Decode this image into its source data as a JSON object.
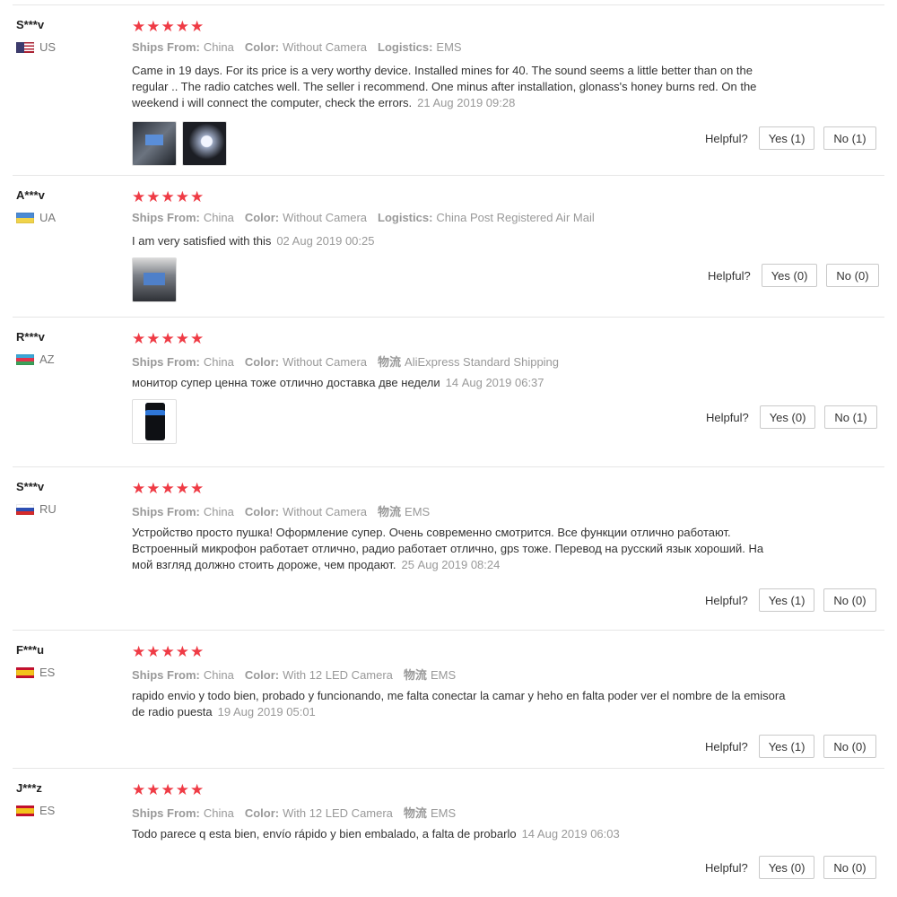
{
  "helpful_label": "Helpful?",
  "colors": {
    "star": "#ef3b45",
    "meta": "#999999",
    "separator": "#e6e6e6"
  },
  "reviews": [
    {
      "user": "S***v",
      "country": "US",
      "flag": "flag-us",
      "stars": "★★★★★",
      "rating": 5,
      "meta": [
        {
          "key": "Ships From:",
          "value": "China"
        },
        {
          "key": "Color:",
          "value": "Without Camera"
        },
        {
          "key": "Logistics:",
          "value": "EMS"
        }
      ],
      "text": "Came in 19 days. For its price is a very worthy device. Installed mines for 40. The sound seems a little better than on the regular .. The radio catches well. The seller i recommend. One minus after installation, glonass's honey burns red. On the weekend i will connect the computer, check the errors.",
      "date": "21 Aug 2019 09:28",
      "photos": [
        "p-a",
        "p-b"
      ],
      "yes": "Yes (1)",
      "no": "No (1)"
    },
    {
      "user": "A***v",
      "country": "UA",
      "flag": "flag-ua",
      "stars": "★★★★★",
      "rating": 5,
      "meta": [
        {
          "key": "Ships From:",
          "value": "China"
        },
        {
          "key": "Color:",
          "value": "Without Camera"
        },
        {
          "key": "Logistics:",
          "value": "China Post Registered Air Mail"
        }
      ],
      "text": "I am very satisfied with this",
      "date": "02 Aug 2019 00:25",
      "photos": [
        "p-c"
      ],
      "yes": "Yes (0)",
      "no": "No (0)"
    },
    {
      "user": "R***v",
      "country": "AZ",
      "flag": "flag-az",
      "stars": "★★★★★",
      "rating": 5,
      "meta": [
        {
          "key": "Ships From:",
          "value": "China"
        },
        {
          "key": "Color:",
          "value": "Without Camera"
        },
        {
          "key": "物流",
          "value": "AliExpress Standard Shipping"
        }
      ],
      "text": "монитор супер ценна тоже отлично доставка две недели",
      "date": "14 Aug 2019 06:37",
      "photos": [
        "p-d"
      ],
      "yes": "Yes (0)",
      "no": "No (1)"
    },
    {
      "user": "S***v",
      "country": "RU",
      "flag": "flag-ru",
      "stars": "★★★★★",
      "rating": 5,
      "meta": [
        {
          "key": "Ships From:",
          "value": "China"
        },
        {
          "key": "Color:",
          "value": "Without Camera"
        },
        {
          "key": "物流",
          "value": "EMS"
        }
      ],
      "text": "Устройство просто пушка! Оформление супер. Очень современно смотрится. Все функции отлично работают. Встроенный микрофон работает отлично, радио работает отлично, gps тоже. Перевод на русский язык хороший. На мой взгляд должно стоить дороже, чем продают.",
      "date": "25 Aug 2019 08:24",
      "photos": [],
      "yes": "Yes (1)",
      "no": "No (0)"
    },
    {
      "user": "F***u",
      "country": "ES",
      "flag": "flag-es",
      "stars": "★★★★★",
      "rating": 5,
      "meta": [
        {
          "key": "Ships From:",
          "value": "China"
        },
        {
          "key": "Color:",
          "value": "With 12 LED Camera"
        },
        {
          "key": "物流",
          "value": "EMS"
        }
      ],
      "text": "rapido envio y todo bien, probado y funcionando, me falta conectar la camar y heho en falta poder ver el nombre de la emisora de radio puesta",
      "date": "19 Aug 2019 05:01",
      "photos": [],
      "yes": "Yes (1)",
      "no": "No (0)"
    },
    {
      "user": "J***z",
      "country": "ES",
      "flag": "flag-es",
      "stars": "★★★★★",
      "rating": 5,
      "meta": [
        {
          "key": "Ships From:",
          "value": "China"
        },
        {
          "key": "Color:",
          "value": "With 12 LED Camera"
        },
        {
          "key": "物流",
          "value": "EMS"
        }
      ],
      "text": "Todo parece q esta bien, envío rápido y bien embalado, a falta de probarlo",
      "date": "14 Aug 2019 06:03",
      "photos": [],
      "yes": "Yes (0)",
      "no": "No (0)"
    }
  ]
}
